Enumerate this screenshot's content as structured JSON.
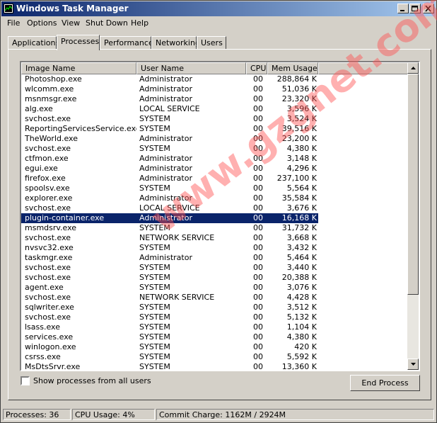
{
  "window": {
    "title": "Windows Task Manager"
  },
  "menu": [
    "File",
    "Options",
    "View",
    "Shut Down",
    "Help"
  ],
  "tabs": [
    {
      "label": "Applications",
      "active": false
    },
    {
      "label": "Processes",
      "active": true
    },
    {
      "label": "Performance",
      "active": false
    },
    {
      "label": "Networking",
      "active": false
    },
    {
      "label": "Users",
      "active": false
    }
  ],
  "columns": [
    "Image Name",
    "User Name",
    "CPU",
    "Mem Usage"
  ],
  "processes": [
    [
      "Photoshop.exe",
      "Administrator",
      "00",
      "288,864 K"
    ],
    [
      "wlcomm.exe",
      "Administrator",
      "00",
      "51,036 K"
    ],
    [
      "msnmsgr.exe",
      "Administrator",
      "00",
      "23,320 K"
    ],
    [
      "alg.exe",
      "LOCAL SERVICE",
      "00",
      "3,596 K"
    ],
    [
      "svchost.exe",
      "SYSTEM",
      "00",
      "3,524 K"
    ],
    [
      "ReportingServicesService.exe",
      "SYSTEM",
      "00",
      "39,516 K"
    ],
    [
      "TheWorld.exe",
      "Administrator",
      "00",
      "23,200 K"
    ],
    [
      "svchost.exe",
      "SYSTEM",
      "00",
      "4,380 K"
    ],
    [
      "ctfmon.exe",
      "Administrator",
      "00",
      "3,148 K"
    ],
    [
      "egui.exe",
      "Administrator",
      "00",
      "4,296 K"
    ],
    [
      "firefox.exe",
      "Administrator",
      "00",
      "237,100 K"
    ],
    [
      "spoolsv.exe",
      "SYSTEM",
      "00",
      "5,564 K"
    ],
    [
      "explorer.exe",
      "Administrator",
      "00",
      "35,584 K"
    ],
    [
      "svchost.exe",
      "LOCAL SERVICE",
      "00",
      "3,676 K"
    ],
    [
      "plugin-container.exe",
      "Administrator",
      "00",
      "16,168 K"
    ],
    [
      "msmdsrv.exe",
      "SYSTEM",
      "00",
      "31,732 K"
    ],
    [
      "svchost.exe",
      "NETWORK SERVICE",
      "00",
      "3,668 K"
    ],
    [
      "nvsvc32.exe",
      "SYSTEM",
      "00",
      "3,432 K"
    ],
    [
      "taskmgr.exe",
      "Administrator",
      "00",
      "5,464 K"
    ],
    [
      "svchost.exe",
      "SYSTEM",
      "00",
      "3,440 K"
    ],
    [
      "svchost.exe",
      "SYSTEM",
      "00",
      "20,388 K"
    ],
    [
      "agent.exe",
      "SYSTEM",
      "00",
      "3,076 K"
    ],
    [
      "svchost.exe",
      "NETWORK SERVICE",
      "00",
      "4,428 K"
    ],
    [
      "sqlwriter.exe",
      "SYSTEM",
      "00",
      "3,512 K"
    ],
    [
      "svchost.exe",
      "SYSTEM",
      "00",
      "5,132 K"
    ],
    [
      "lsass.exe",
      "SYSTEM",
      "00",
      "1,104 K"
    ],
    [
      "services.exe",
      "SYSTEM",
      "00",
      "4,380 K"
    ],
    [
      "winlogon.exe",
      "SYSTEM",
      "00",
      "420 K"
    ],
    [
      "csrss.exe",
      "SYSTEM",
      "00",
      "5,592 K"
    ],
    [
      "MsDtsSrvr.exe",
      "SYSTEM",
      "00",
      "13,360 K"
    ]
  ],
  "selected_row": 14,
  "show_all_label": "Show processes from all users",
  "show_all_checked": false,
  "end_process_label": "End Process",
  "status": {
    "processes": "Processes: 36",
    "cpu": "CPU Usage: 4%",
    "commit": "Commit Charge: 1162M / 2924M"
  },
  "watermark": "www.gzgnet.com",
  "colors": {
    "title_start": "#0a246a",
    "title_end": "#a6caf0",
    "selection": "#0a246a",
    "face": "#d4d0c8"
  }
}
